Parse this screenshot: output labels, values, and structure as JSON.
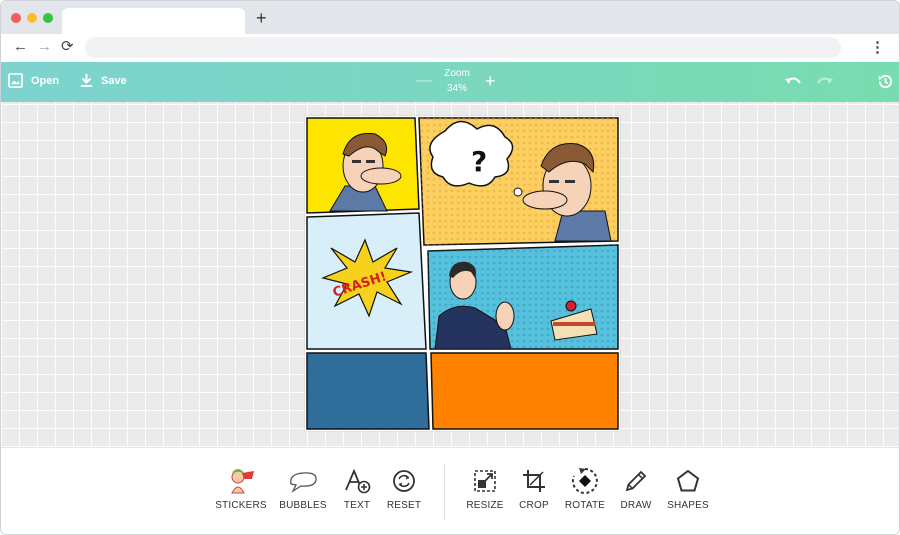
{
  "browser": {
    "new_tab": "+",
    "back": "←",
    "forward": "→",
    "reload": "⟳",
    "menu": "⋮"
  },
  "toolbar": {
    "open_label": "Open",
    "save_label": "Save",
    "zoom_label": "Zoom",
    "zoom_value": "34%",
    "zoom_minus": "—",
    "zoom_plus": "+"
  },
  "comic": {
    "question_mark": "?",
    "sfx_text": "CRASH!",
    "panel_colors": [
      "#fde500",
      "#fbcf60",
      "#cfe8f6",
      "#4cb9d8",
      "#2f6d9b",
      "#ff8300"
    ]
  },
  "tools": {
    "left": [
      {
        "label": "STICKERS",
        "icon": "sticker-icon"
      },
      {
        "label": "BUBBLES",
        "icon": "speech-bubble-icon"
      },
      {
        "label": "TEXT",
        "icon": "text-add-icon"
      },
      {
        "label": "RESET",
        "icon": "reset-icon"
      }
    ],
    "right": [
      {
        "label": "RESIZE",
        "icon": "resize-icon"
      },
      {
        "label": "CROP",
        "icon": "crop-icon"
      },
      {
        "label": "ROTATE",
        "icon": "rotate-icon"
      },
      {
        "label": "DRAW",
        "icon": "pencil-icon"
      },
      {
        "label": "SHAPES",
        "icon": "pentagon-icon"
      }
    ]
  },
  "colors": {
    "toolbar_start": "#7dd3cf",
    "toolbar_end": "#79dcb0"
  }
}
